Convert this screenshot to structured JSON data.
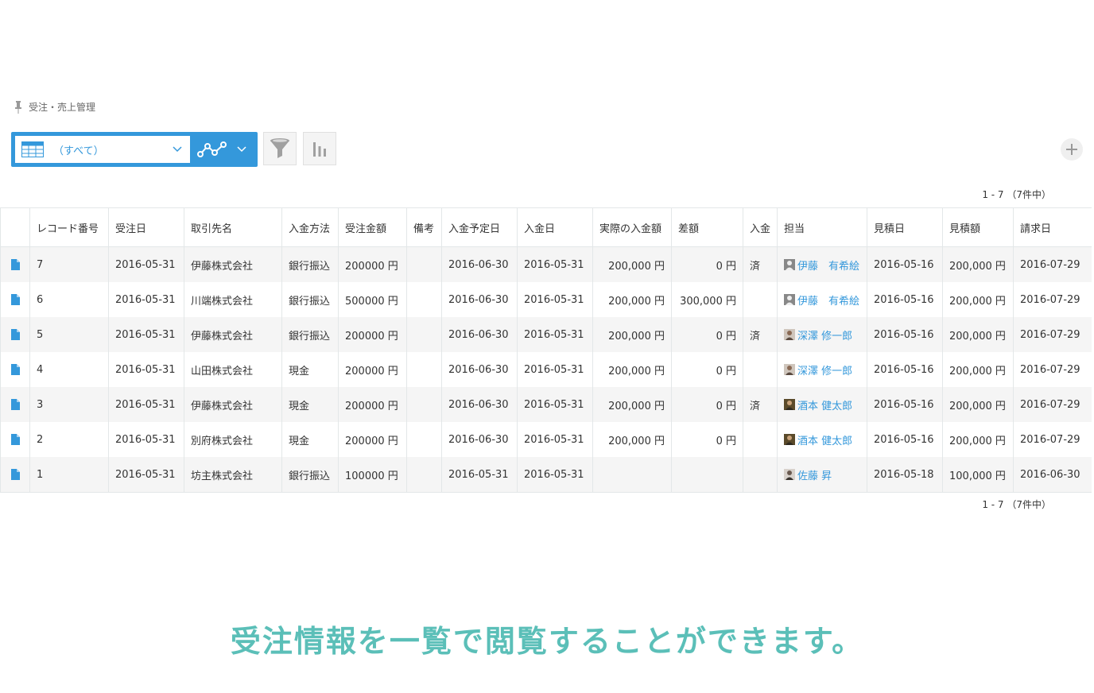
{
  "breadcrumb": {
    "app_name": "受注・売上管理"
  },
  "toolbar": {
    "view_label": "（すべて）"
  },
  "pagination": {
    "top": "1 - 7 （7件中）",
    "bottom": "1 - 7 （7件中）"
  },
  "table": {
    "headers": [
      "レコード番号",
      "受注日",
      "取引先名",
      "入金方法",
      "受注金額",
      "備考",
      "入金予定日",
      "入金日",
      "実際の入金額",
      "差額",
      "入金",
      "担当",
      "見積日",
      "見積額",
      "請求日"
    ],
    "rows": [
      {
        "no": "7",
        "order_date": "2016-05-31",
        "client": "伊藤株式会社",
        "method": "銀行振込",
        "amount": "200000 円",
        "note": "",
        "due": "2016-06-30",
        "paid": "2016-05-31",
        "actual": "200,000 円",
        "diff": "0 円",
        "status": "済",
        "rep": "伊藤　有希絵",
        "avatar": "gray",
        "est_date": "2016-05-16",
        "est_amount": "200,000 円",
        "invoice": "2016-07-29"
      },
      {
        "no": "6",
        "order_date": "2016-05-31",
        "client": "川端株式会社",
        "method": "銀行振込",
        "amount": "500000 円",
        "note": "",
        "due": "2016-06-30",
        "paid": "2016-05-31",
        "actual": "200,000 円",
        "diff": "300,000 円",
        "status": "",
        "rep": "伊藤　有希絵",
        "avatar": "gray",
        "est_date": "2016-05-16",
        "est_amount": "200,000 円",
        "invoice": "2016-07-29"
      },
      {
        "no": "5",
        "order_date": "2016-05-31",
        "client": "伊藤株式会社",
        "method": "銀行振込",
        "amount": "200000 円",
        "note": "",
        "due": "2016-06-30",
        "paid": "2016-05-31",
        "actual": "200,000 円",
        "diff": "0 円",
        "status": "済",
        "rep": "深澤 修一郎",
        "avatar": "photo1",
        "est_date": "2016-05-16",
        "est_amount": "200,000 円",
        "invoice": "2016-07-29"
      },
      {
        "no": "4",
        "order_date": "2016-05-31",
        "client": "山田株式会社",
        "method": "現金",
        "amount": "200000 円",
        "note": "",
        "due": "2016-06-30",
        "paid": "2016-05-31",
        "actual": "200,000 円",
        "diff": "0 円",
        "status": "",
        "rep": "深澤 修一郎",
        "avatar": "photo1",
        "est_date": "2016-05-16",
        "est_amount": "200,000 円",
        "invoice": "2016-07-29"
      },
      {
        "no": "3",
        "order_date": "2016-05-31",
        "client": "伊藤株式会社",
        "method": "現金",
        "amount": "200000 円",
        "note": "",
        "due": "2016-06-30",
        "paid": "2016-05-31",
        "actual": "200,000 円",
        "diff": "0 円",
        "status": "済",
        "rep": "酒本 健太郎",
        "avatar": "photo2",
        "est_date": "2016-05-16",
        "est_amount": "200,000 円",
        "invoice": "2016-07-29"
      },
      {
        "no": "2",
        "order_date": "2016-05-31",
        "client": "別府株式会社",
        "method": "現金",
        "amount": "200000 円",
        "note": "",
        "due": "2016-06-30",
        "paid": "2016-05-31",
        "actual": "200,000 円",
        "diff": "0 円",
        "status": "",
        "rep": "酒本 健太郎",
        "avatar": "photo2",
        "est_date": "2016-05-16",
        "est_amount": "200,000 円",
        "invoice": "2016-07-29"
      },
      {
        "no": "1",
        "order_date": "2016-05-31",
        "client": "坊主株式会社",
        "method": "銀行振込",
        "amount": "100000 円",
        "note": "",
        "due": "2016-05-31",
        "paid": "2016-05-31",
        "actual": "",
        "diff": "",
        "status": "",
        "rep": "佐藤 昇",
        "avatar": "photo3",
        "est_date": "2016-05-18",
        "est_amount": "100,000 円",
        "invoice": "2016-06-30"
      }
    ]
  },
  "caption": "受注情報を一覧で閲覧することができます。",
  "colors": {
    "accent": "#3498db",
    "caption": "#5bbfb8",
    "row_alt": "#f5f5f5"
  }
}
